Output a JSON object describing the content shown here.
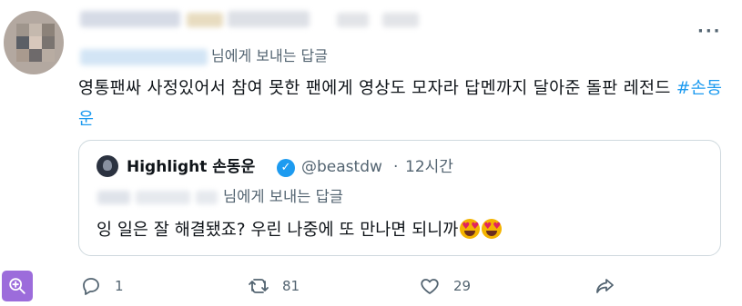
{
  "tweet": {
    "reply_to_suffix": "님에게 보내는 답글",
    "text_main": "영통팬싸 사정있어서 참여 못한 팬에게 영상도 모자라 답멘까지 달아준 돌판 레전드 ",
    "hashtag": "#손동운"
  },
  "quoted": {
    "display_name": "Highlight 손동운",
    "handle": "@beastdw",
    "separator": "·",
    "time": "12시간",
    "reply_to_suffix": "님에게 보내는 답글",
    "text": "잉 일은 잘 해결됐죠? 우린 나중에 또 만나면 되니까"
  },
  "actions": {
    "reply_count": "1",
    "retweet_count": "81",
    "like_count": "29"
  },
  "icons": {
    "more": "more-horizontal-icon",
    "verified": "verified-badge-icon",
    "reply": "reply-icon",
    "retweet": "retweet-icon",
    "like": "heart-icon",
    "share": "share-icon",
    "zoom": "zoom-in-icon"
  },
  "colors": {
    "accent": "#1d9bf0",
    "secondary_text": "#536471",
    "border": "#cfd9de",
    "zoom_button": "#9c6cdb"
  }
}
